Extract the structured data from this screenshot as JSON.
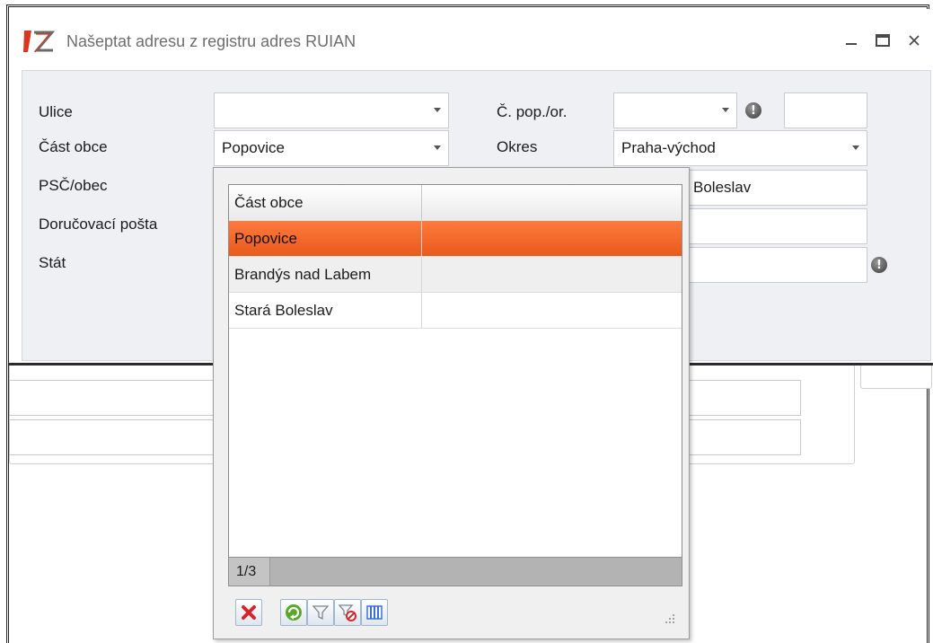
{
  "dialog": {
    "title": "Našeptat adresu z registru adres RUIAN"
  },
  "form": {
    "ulice_label": "Ulice",
    "ulice_value": "",
    "cast_obce_label": "Část obce",
    "cast_obce_value": "Popovice",
    "psc_obec_label": "PSČ/obec",
    "psc_obec_value_visible": "Boleslav",
    "dorucovaci_posta_label": "Doručovací pošta",
    "stat_label": "Stát",
    "cislo_pop_or_label": "Č. pop./or.",
    "cislo_pop_value": "",
    "cislo_or_value": "",
    "okres_label": "Okres",
    "okres_value": "Praha-východ"
  },
  "popup": {
    "column_header": "Část obce",
    "rows": [
      "Popovice",
      "Brandýs nad Labem",
      "Stará Boleslav"
    ],
    "selected_index": 0,
    "pager_text": "1/3"
  },
  "colors": {
    "selected_row": "#e85a1c",
    "logo_red": "#d9381e"
  }
}
